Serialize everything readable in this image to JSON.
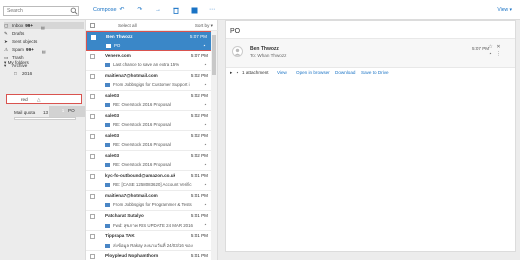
{
  "search": {
    "placeholder": "Search"
  },
  "toolbar": {
    "compose_label": "Compose",
    "view_label": "View"
  },
  "sidebar": {
    "folders": [
      {
        "label": "Inbox",
        "count": "99+",
        "icon": "inbox-icon"
      },
      {
        "label": "Drafts",
        "count": "",
        "icon": "drafts-icon"
      },
      {
        "label": "Sent objects",
        "count": "",
        "icon": "sent-icon"
      },
      {
        "label": "Spam",
        "count": "99+",
        "icon": "spam-icon"
      },
      {
        "label": "Trash",
        "count": "",
        "icon": "trash-icon"
      },
      {
        "label": "Archive",
        "count": "",
        "icon": "archive-icon"
      },
      {
        "label": "2016",
        "count": "",
        "icon": "folder-icon"
      }
    ],
    "my_folders_label": "My folders",
    "custom_folder": {
      "label": "red"
    },
    "mail_quota_label": "Mail quota",
    "mail_quota_value": "13",
    "drag": {
      "count": "1",
      "subject": "PO"
    }
  },
  "list": {
    "select_all_label": "Select all",
    "sort_label": "Sort by",
    "messages": [
      {
        "from": "Ben Thwozz",
        "time": "5:07 PM",
        "subject": "PO",
        "selected": true
      },
      {
        "from": "Venere.com",
        "time": "5:07 PM",
        "subject": "Last chance to save an extra 15%"
      },
      {
        "from": "maitiena7@hotmail.com",
        "time": "5:02 PM",
        "subject": "From Jobbsgigs for Customer Support i"
      },
      {
        "from": "sale03",
        "time": "5:02 PM",
        "subject": "RE: Overstock 2016 Proposal"
      },
      {
        "from": "sale03",
        "time": "5:02 PM",
        "subject": "RE: Overstock 2016 Proposal"
      },
      {
        "from": "sale03",
        "time": "5:02 PM",
        "subject": "RE: Overstock 2016 Proposal"
      },
      {
        "from": "sale03",
        "time": "5:02 PM",
        "subject": "RE: Overstock 2016 Proposal"
      },
      {
        "from": "kyc-fo-outbound@amazon.co.uk",
        "time": "5:01 PM",
        "subject": "RE: [CASE 1258083620] Account Verific"
      },
      {
        "from": "maitiena7@hotmail.com",
        "time": "5:01 PM",
        "subject": "From Jobbsgigs for Programmer & Tests"
      },
      {
        "from": "Patcharat Sutalyo",
        "time": "5:01 PM",
        "subject": "Fwd: สุขภาพ RIS UPDATE 24 MAR 2016"
      },
      {
        "from": "Tipprapa TAK",
        "time": "5:01 PM",
        "subject": "ส่งข้อมูล Rakay ลงนามวันที่ 24/03/16 ของ"
      },
      {
        "from": "Ploypleud Nophamthorn",
        "time": "5:01 PM",
        "subject": ""
      }
    ]
  },
  "reading": {
    "subject": "PO",
    "sender": "Ben Thwozz",
    "to": "To: Whan Thwozz",
    "time": "5:07 PM",
    "attachment_count": "1 attachment",
    "actions": [
      "View",
      "Open in browser",
      "Download",
      "Save to Drive"
    ]
  },
  "colors": {
    "accent": "#1a73c5",
    "selected_row": "#3a87c8",
    "highlight_border": "#d9534f"
  }
}
